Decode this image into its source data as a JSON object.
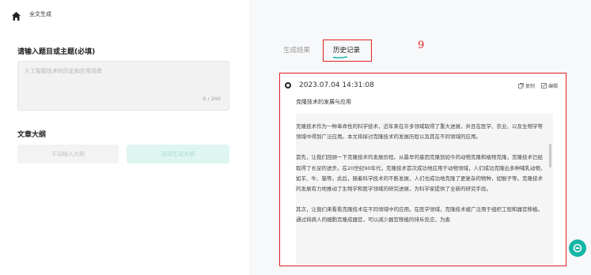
{
  "header": {
    "app_title": "全文生成",
    "home_icon": "home-icon"
  },
  "form": {
    "topic_label": "请输入题目或主题(必填)",
    "topic_placeholder": "人工智能技术的历史和应用场景",
    "char_count": "0 / 200",
    "outline_label": "文章大纲",
    "manual_button": "手动输入大纲",
    "auto_button": "自动生成大纲"
  },
  "tabs": [
    {
      "label": "生成结果",
      "active": false
    },
    {
      "label": "历史记录",
      "active": true
    }
  ],
  "annotation": {
    "number": "9"
  },
  "record": {
    "time": "2023.07.04 14:31:08",
    "copy_label": "复制",
    "edit_label": "编辑",
    "title": "克隆技术的发展与应用",
    "paragraphs": [
      "克隆技术作为一种革命性的科学技术，近年来在许多领域取得了重大进展，并且在医学、农业、以及生物学等领域中得到广泛应用。本文将探讨克隆技术的发展历程以及其在不同领域的应用。",
      "首先，让我们回顾一下克隆技术的发展历程。从最早的基因克隆到如今的动物克隆和植物克隆，克隆技术已经取得了长足的进步。在20世纪90年代，克隆技术首次成功地应用于动物领域，人们成功克隆出多种哺乳动物，如羊、牛、猫等。此后，随着科学技术的不断发展，人们也成功地克隆了更复杂的物种，如猴子等。克隆技术的发展有力地推动了生物学和医学领域的研究进展，为科学家提供了全新的研究手段。",
      "其次，让我们来看看克隆技术在不同领域中的应用。在医学领域，克隆技术被广泛用于组织工程和器官移植。通过将病人的细胞克隆成器官，可以减少器官移植的排斥反应，为患"
    ]
  },
  "colors": {
    "accent": "#13b5a4",
    "highlight": "#e02020"
  }
}
